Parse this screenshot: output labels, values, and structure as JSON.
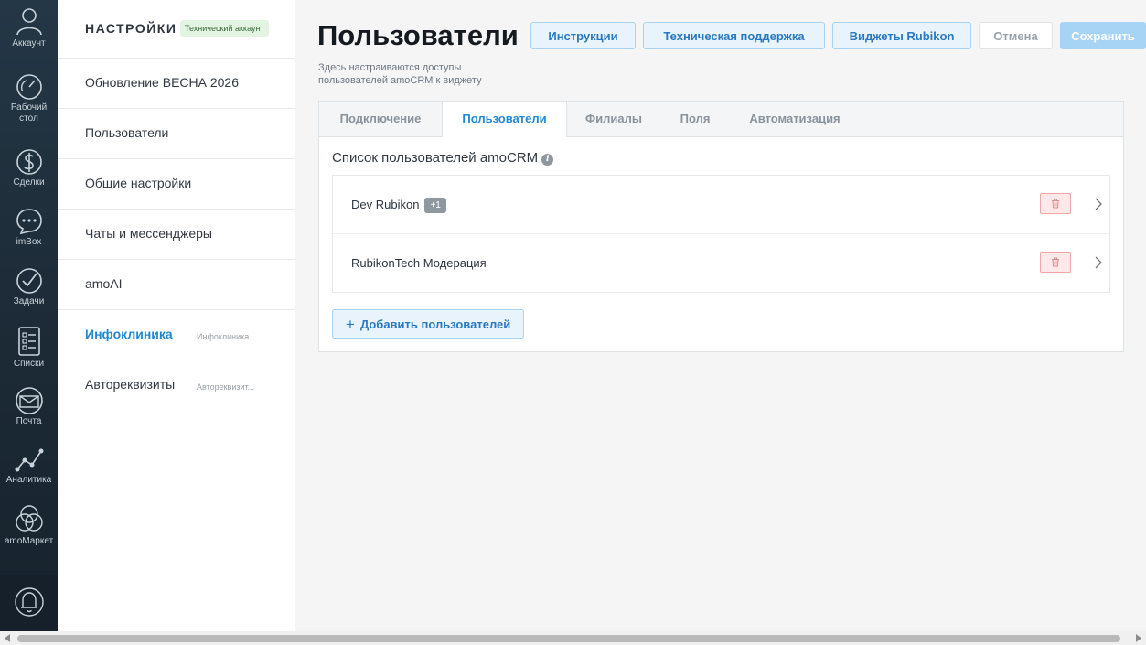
{
  "nav": {
    "items": [
      {
        "label": "Аккаунт",
        "icon": "account-icon"
      },
      {
        "label": "Рабочий стол",
        "icon": "dashboard-icon"
      },
      {
        "label": "Сделки",
        "icon": "deals-icon"
      },
      {
        "label": "imBox",
        "icon": "chat-icon"
      },
      {
        "label": "Задачи",
        "icon": "tasks-icon"
      },
      {
        "label": "Списки",
        "icon": "lists-icon"
      },
      {
        "label": "Почта",
        "icon": "mail-icon"
      },
      {
        "label": "Аналитика",
        "icon": "analytics-icon"
      },
      {
        "label": "amoМаркет",
        "icon": "market-icon"
      }
    ],
    "bell_icon": "bell-icon"
  },
  "settings": {
    "title": "НАСТРОЙКИ",
    "badge": "Технический аккаунт",
    "items": [
      {
        "label": "Обновление ВЕСНА 2026",
        "sub": ""
      },
      {
        "label": "Пользователи",
        "sub": ""
      },
      {
        "label": "Общие настройки",
        "sub": ""
      },
      {
        "label": "Чаты и мессенджеры",
        "sub": ""
      },
      {
        "label": "amoAI",
        "sub": ""
      },
      {
        "label": "Инфоклиника",
        "sub": "Инфоклиника ..."
      },
      {
        "label": "Автореквизиты",
        "sub": "Автореквизит..."
      }
    ]
  },
  "header": {
    "title": "Пользователи",
    "description": "Здесь настраиваются доступы пользователей amoCRM к виджету",
    "buttons": {
      "instructions": "Инструкции",
      "support": "Техническая поддержка",
      "widgets": "Виджеты Rubikon",
      "cancel": "Отмена",
      "save": "Сохранить"
    }
  },
  "tabs": [
    "Подключение",
    "Пользователи",
    "Филиалы",
    "Поля",
    "Автоматизация"
  ],
  "active_tab": "Пользователи",
  "users_section": {
    "title": "Список пользователей amoCRM",
    "info_icon": "i",
    "users": [
      {
        "name": "Dev Rubikon",
        "badge": "+1"
      },
      {
        "name": "RubikonTech Модерация",
        "badge": ""
      }
    ],
    "add_button": "Добавить пользователей",
    "add_icon": "+"
  },
  "colors": {
    "accent": "#2188d5",
    "nav_bg": "#1d2c38",
    "delete": "#f3a6a6"
  }
}
